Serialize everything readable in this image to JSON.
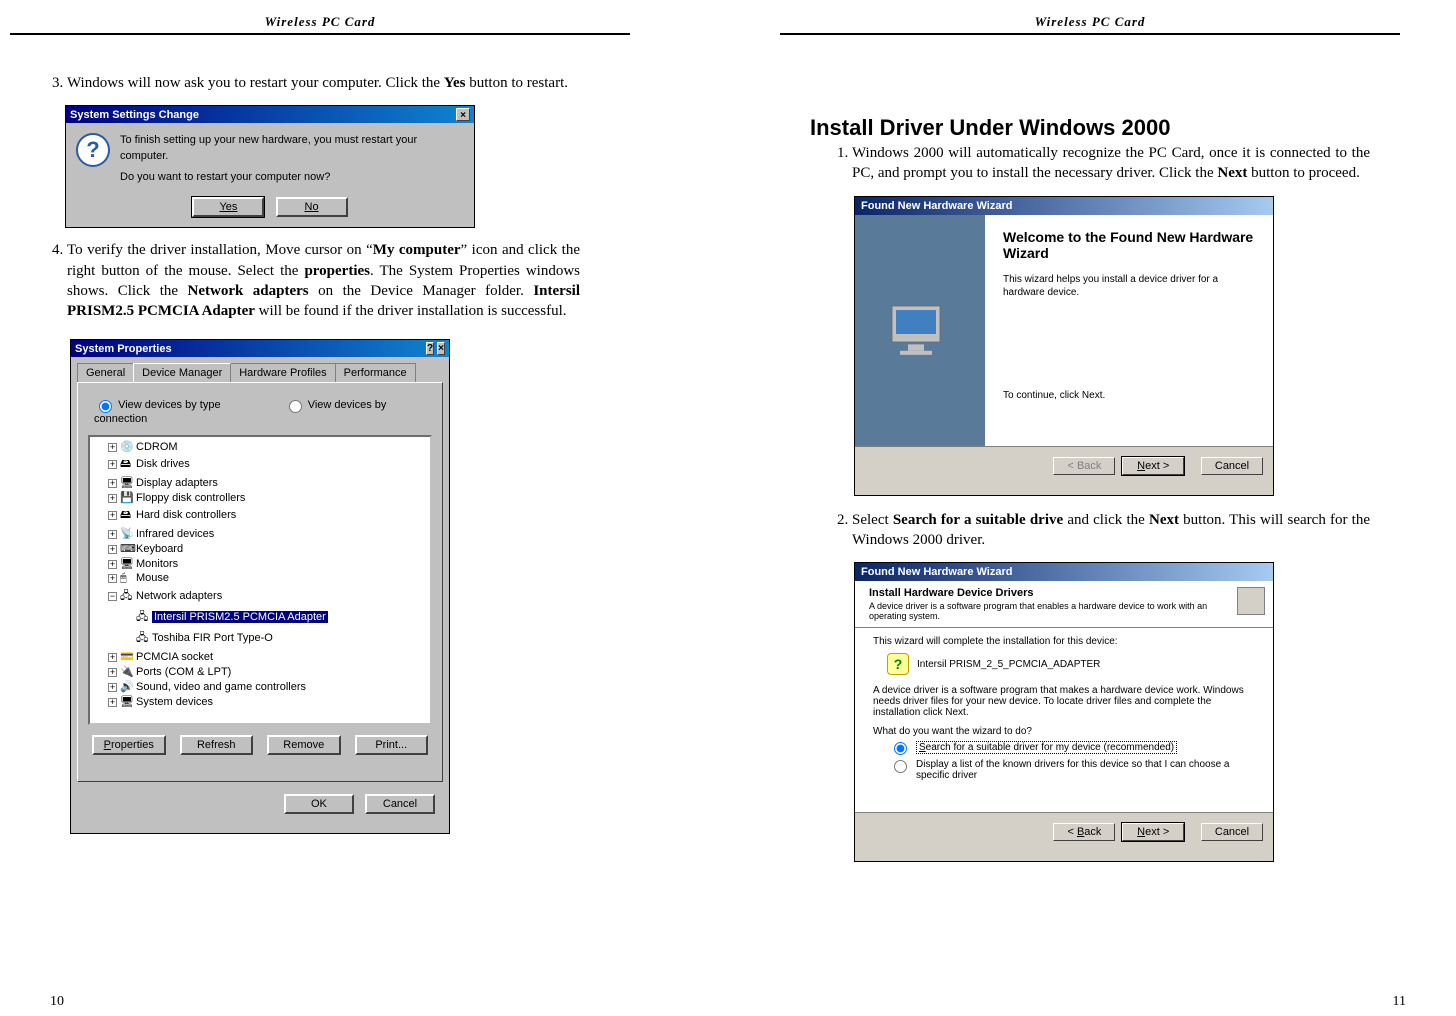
{
  "header_left": "Wireless  PC  Card",
  "header_right": "Wireless  PC  Card",
  "page_number_left": "10",
  "page_number_right": "11",
  "left": {
    "step3_num": "3.",
    "step3_text_pre": "Windows will now ask you to restart your computer. Click the ",
    "step3_bold1": "Yes",
    "step3_text_post": " button to restart.",
    "dlg_title": "System Settings Change",
    "dlg_line1": "To finish setting up your new hardware, you must restart your computer.",
    "dlg_line2": "Do you want to restart your computer now?",
    "dlg_yes": "Yes",
    "dlg_no": "No",
    "step4_num": "4.",
    "step4_text_1": "To verify the driver installation, Move cursor on “",
    "step4_bold1": "My computer",
    "step4_text_2": "” icon and click the right button of the mouse. Select the ",
    "step4_bold2": "properties",
    "step4_text_3": ". The System Properties windows shows. Click the ",
    "step4_bold3": "Network adapters",
    "step4_text_4": " on the Device Manager folder. ",
    "step4_bold4": "Intersil PRISM2.5 PCMCIA Adapter",
    "step4_text_5": " will be found if the driver installation is successful.",
    "sysprop_title": "System Properties",
    "tabs": [
      "General",
      "Device Manager",
      "Hardware Profiles",
      "Performance"
    ],
    "radio1": "View devices by type",
    "radio2": "View devices by connection",
    "tree": [
      "CDROM",
      "Disk drives",
      "Display adapters",
      "Floppy disk controllers",
      "Hard disk controllers",
      "Infrared devices",
      "Keyboard",
      "Monitors",
      "Mouse",
      "Network adapters",
      "Intersil PRISM2.5 PCMCIA Adapter",
      "Toshiba FIR Port Type-O",
      "PCMCIA socket",
      "Ports (COM & LPT)",
      "Sound, video and game controllers",
      "System devices"
    ],
    "btn_properties": "Properties",
    "btn_refresh": "Refresh",
    "btn_remove": "Remove",
    "btn_print": "Print...",
    "btn_ok": "OK",
    "btn_cancel": "Cancel"
  },
  "right": {
    "section_title": "Install Driver Under Windows 2000",
    "step1_num": "1.",
    "step1_text_1": "Windows 2000 will automatically recognize the PC Card, once it is connected to the PC, and prompt you to install the necessary driver. Click the ",
    "step1_bold1": "Next",
    "step1_text_2": " button to proceed.",
    "wiz_title": "Found New Hardware Wizard",
    "wiz_welcome_h": "Welcome to the Found New Hardware Wizard",
    "wiz_welcome_p": "This wizard helps you install a device driver for a hardware device.",
    "wiz_continue": "To continue, click Next.",
    "btn_back": "< Back",
    "btn_next": "Next >",
    "btn_cancel": "Cancel",
    "step2_num": "2.",
    "step2_text_1": "Select ",
    "step2_bold1": "Search for a suitable drive",
    "step2_text_2": " and click the ",
    "step2_bold2": "Next",
    "step2_text_3": " button. This will search for the Windows 2000 driver.",
    "wiz2_h": "Install Hardware Device Drivers",
    "wiz2_d": "A device driver is a software program that enables a hardware device to work with an operating system.",
    "wiz2_complete": "This wizard will complete the installation for this device:",
    "wiz2_device": "Intersil PRISM_2_5_PCMCIA_ADAPTER",
    "wiz2_p": "A device driver is a software program that makes a hardware device work. Windows needs driver files for your new device. To locate driver files and complete the installation click Next.",
    "wiz2_q": "What do you want the wizard to do?",
    "wiz2_r1": "Search for a suitable driver for my device (recommended)",
    "wiz2_r1_key": "S",
    "wiz2_r2": "Display a list of the known drivers for this device so that I can choose a specific driver",
    "btn_back2": "< Back",
    "btn_next2": "Next >",
    "btn_cancel2": "Cancel"
  }
}
